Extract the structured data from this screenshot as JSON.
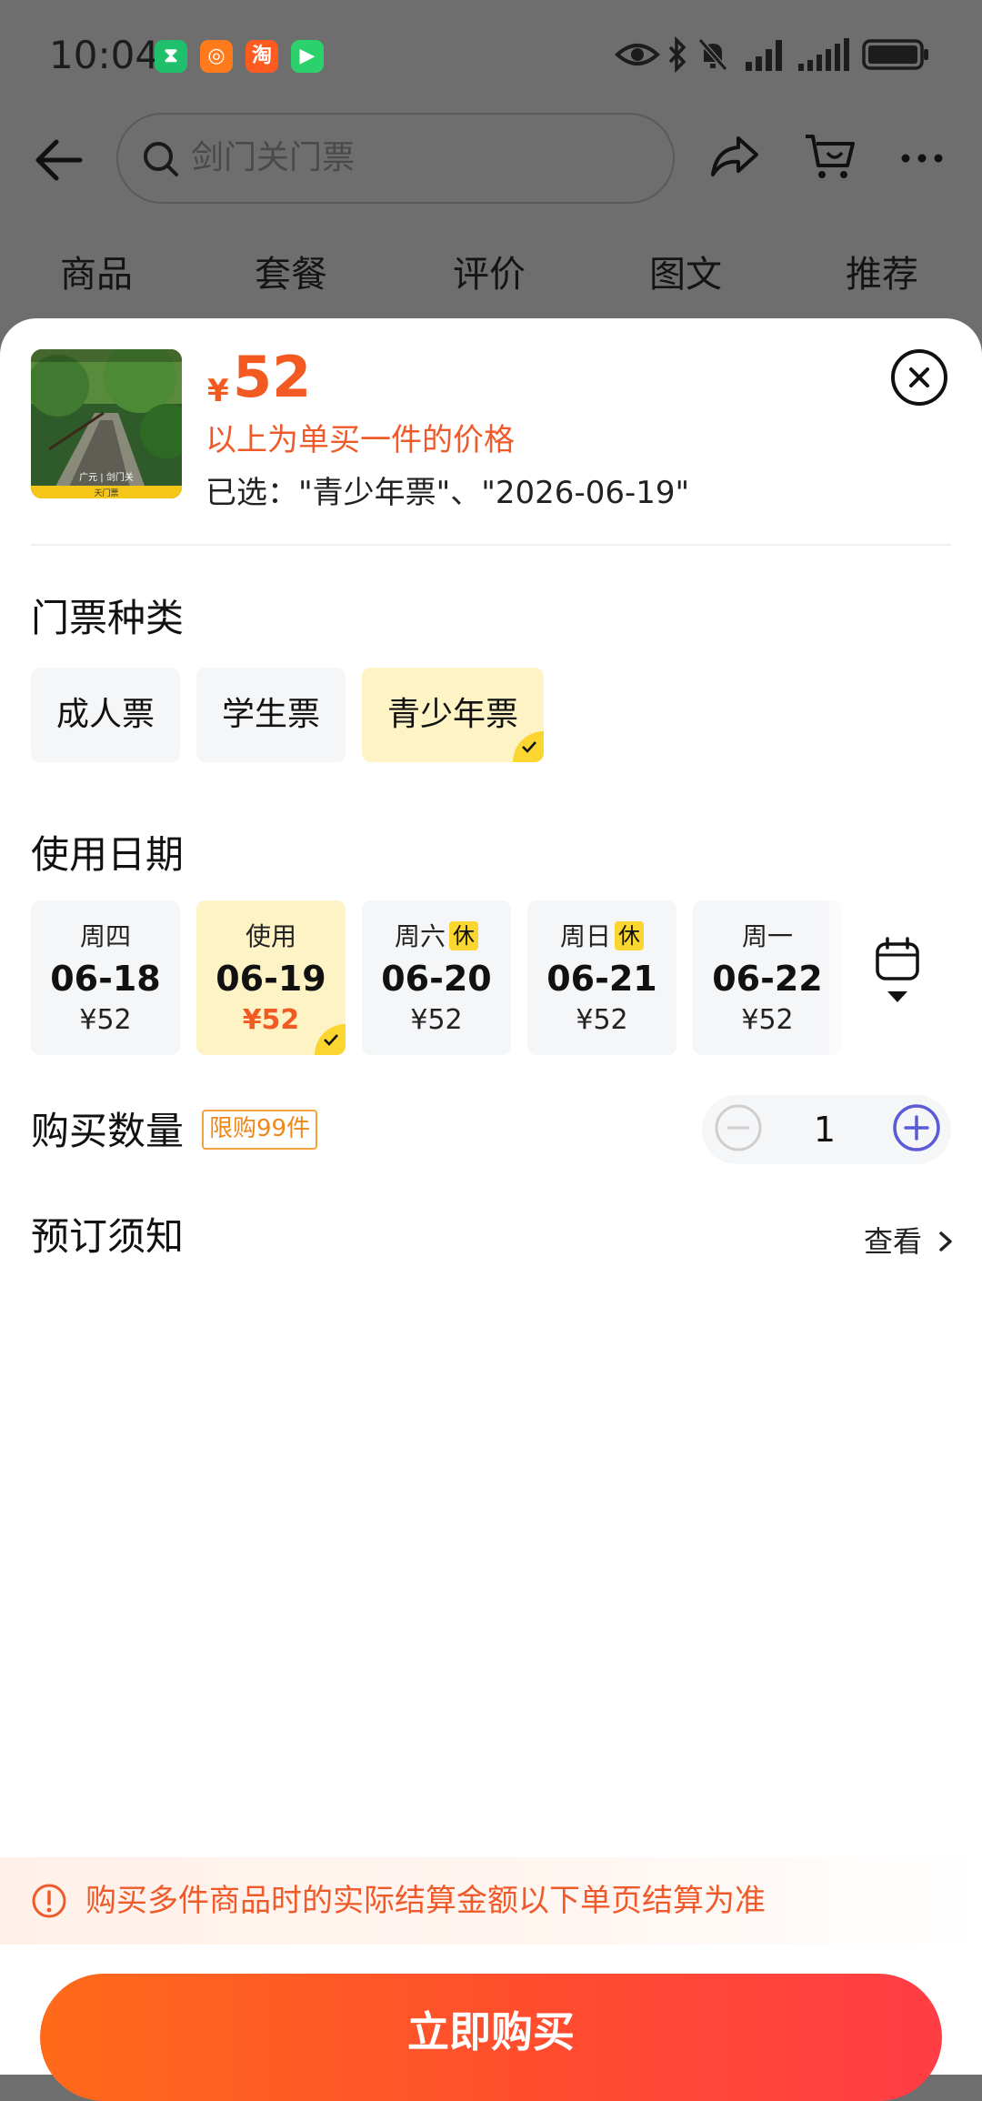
{
  "status_bar": {
    "time": "10:04"
  },
  "header": {
    "search": {
      "text": "剑门关门票"
    },
    "tabs": [
      "商品",
      "套餐",
      "评价",
      "图文",
      "推荐"
    ]
  },
  "product": {
    "thumb_caption": "广元 | 剑门关",
    "thumb_footer": "天门票",
    "currency": "¥",
    "price": "52",
    "price_note": "以上为单买一件的价格",
    "selected": "已选：\"青少年票\"、\"2026-06-19\""
  },
  "ticket_type": {
    "title": "门票种类",
    "options": [
      {
        "label": "成人票",
        "selected": false
      },
      {
        "label": "学生票",
        "selected": false
      },
      {
        "label": "青少年票",
        "selected": true
      }
    ]
  },
  "usage_date": {
    "title": "使用日期",
    "dates": [
      {
        "week": "周四",
        "date": "06-18",
        "price": "¥52",
        "holiday": ""
      },
      {
        "week": "使用",
        "date": "06-19",
        "price": "¥52",
        "holiday": ""
      },
      {
        "week": "周六",
        "date": "06-20",
        "price": "¥52",
        "holiday": "休"
      },
      {
        "week": "周日",
        "date": "06-21",
        "price": "¥52",
        "holiday": "休"
      },
      {
        "week": "周一",
        "date": "06-22",
        "price": "¥52",
        "holiday": ""
      }
    ],
    "selected_index": 1
  },
  "quantity": {
    "title": "购买数量",
    "limit": "限购99件",
    "value": "1"
  },
  "booking_notes": {
    "title": "预订须知",
    "view": "查看"
  },
  "tip": {
    "text": "购买多件商品时的实际结算金额以下单页结算为准"
  },
  "buy_button": {
    "label": "立即购买"
  },
  "colors": {
    "accent": "#f25a22",
    "highlight": "#fbd630",
    "selected_bg": "#fdf3c5",
    "plus": "#5b5bd6"
  }
}
